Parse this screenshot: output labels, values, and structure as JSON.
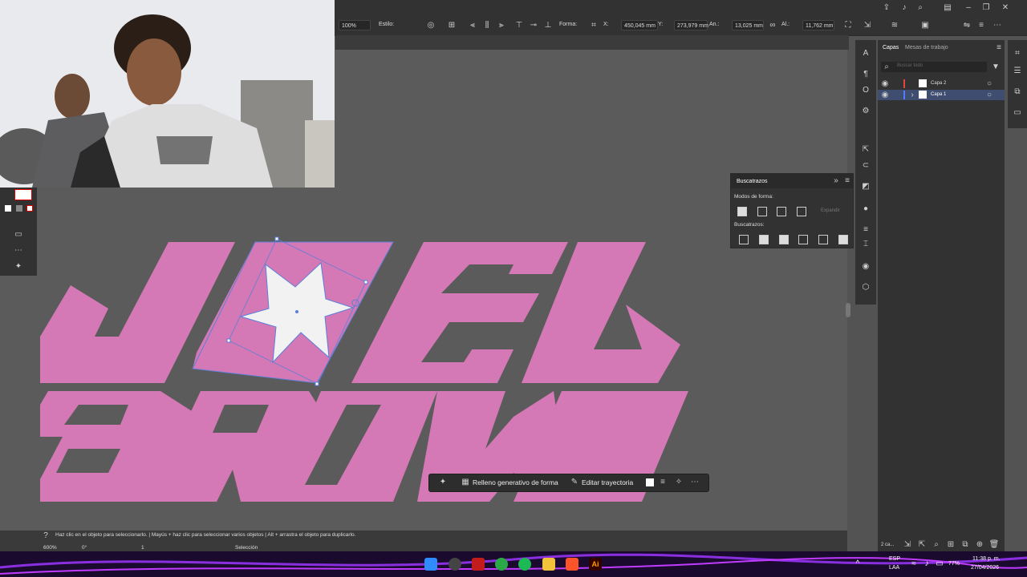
{
  "control_bar": {
    "zoom_value": "100%",
    "style_label": "Estilo:",
    "shape_label": "Forma:",
    "x_label": "X:",
    "x_value": "450,045 mm",
    "y_label": "Y:",
    "y_value": "273,979 mm",
    "w_label": "An.:",
    "w_value": "13,025 mm",
    "h_label": "Al.:",
    "h_value": "11,762 mm"
  },
  "layers_panel": {
    "tabs": [
      "Capas",
      "Mesas de trabajo"
    ],
    "search_placeholder": "Buscar todo",
    "layers": [
      {
        "name": "Capa 2",
        "color": "#e0483e"
      },
      {
        "name": "Capa 1",
        "color": "#4f7fff"
      }
    ],
    "footer_count": "2 ca..."
  },
  "pathfinder_panel": {
    "title": "Buscatrazos",
    "shape_modes_label": "Modos de forma:",
    "expand_label": "Expandir",
    "pathfinders_label": "Buscatrazos:"
  },
  "context_bar": {
    "generative_fill": "Relleno generativo de forma",
    "edit_path": "Editar trayectoria"
  },
  "status_bar": {
    "hint": "Haz clic en el objeto para seleccionarlo.  |  Mayús + haz clic para seleccionar varios objetos  |  Alt + arrastra el objeto para duplicarlo.",
    "zoom": "600%",
    "rotation": "0°",
    "artboard": "1",
    "tool": "Selección"
  },
  "artwork": {
    "line1": "JOEL",
    "line2": "BROWN",
    "fill_color": "#d479b5"
  },
  "taskbar": {
    "language": "ESP",
    "language_sub": "LAA",
    "battery": "77%",
    "time": "11:38 p. m.",
    "date": "27/04/2026",
    "app_label": "Ai"
  }
}
